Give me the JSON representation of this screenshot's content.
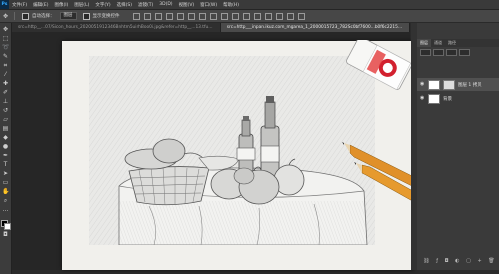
{
  "app": {
    "logo": "Ps"
  },
  "menu": [
    "文件(F)",
    "编辑(E)",
    "图像(I)",
    "图层(L)",
    "文字(Y)",
    "选择(S)",
    "滤镜(T)",
    "3D(D)",
    "视图(V)",
    "窗口(W)",
    "帮助(H)"
  ],
  "options": {
    "auto_select_label": "自动选择：",
    "auto_select_value": "图层",
    "transform_label": "显示变换控件"
  },
  "tabs": [
    {
      "label": "src=http__...07/Sicon_hours_2020051912346Bnhtm5uirhBoo0i.jpg&refer=http__...13.tfu.jpg @ 50%..."
    },
    {
      "label": "src=http___inpan.ikuz.com_mgarea_1_2000015723_782Sc0bf7600...b0f6c22157b9Bfi.jpg&refer=http___img.aif.cn"
    }
  ],
  "panel": {
    "tabs": [
      "图层",
      "通道",
      "路径"
    ],
    "layers": [
      {
        "name": "图层 1 拷贝"
      },
      {
        "name": "背景"
      }
    ]
  },
  "colors": {
    "accent": "#31a8ff",
    "canvas_bg": "#262626",
    "panel_bg": "#3a3a3a"
  }
}
